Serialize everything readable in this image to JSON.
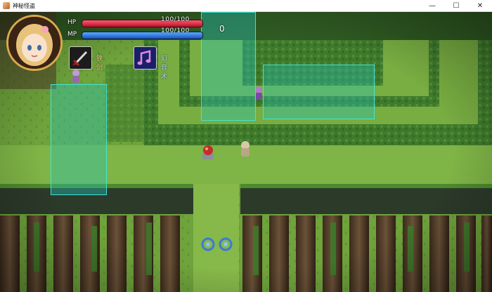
{
  "window": {
    "title": "神秘怪盗",
    "controls": {
      "minimize": "—",
      "maximize": "☐",
      "close": "✕"
    }
  },
  "hud": {
    "hp": {
      "label": "HP",
      "value_text": "100/100",
      "fraction": 1.0,
      "color": "#d01a30"
    },
    "mp": {
      "label": "MP",
      "value_text": "100/100",
      "fraction": 1.0,
      "color": "#2a6ad8"
    },
    "skills": [
      {
        "name": "铁剑",
        "icon": "sword-icon"
      },
      {
        "name": "幻音术",
        "icon": "music-note-icon"
      }
    ]
  },
  "overlay": {
    "counter": "0",
    "zone_color": "#26c4ba"
  }
}
